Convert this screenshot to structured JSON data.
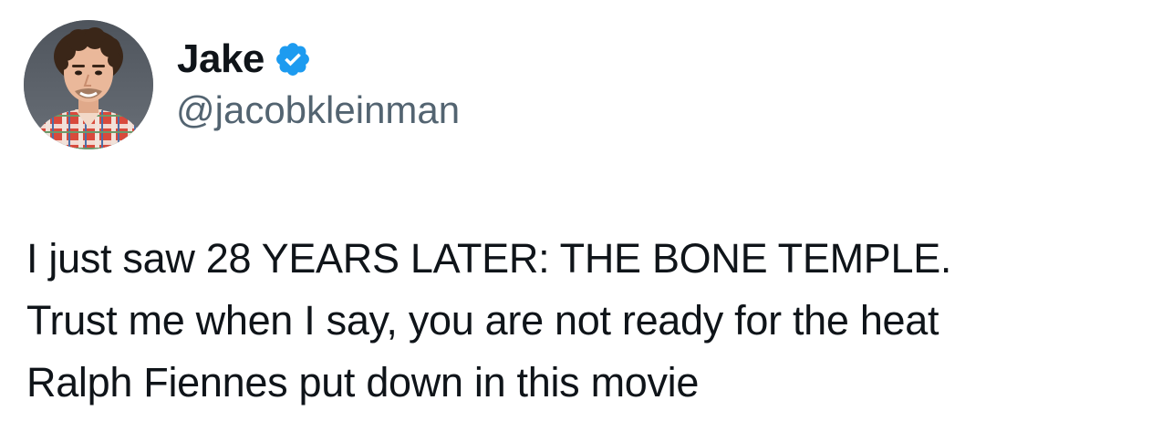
{
  "tweet": {
    "author": {
      "display_name": "Jake",
      "handle": "@jacobkleinman",
      "verified": true,
      "avatar_icon": "profile-photo"
    },
    "text_lines": [
      "I just saw 28 YEARS LATER: THE BONE TEMPLE.",
      "Trust me when I say, you are not ready for the heat",
      "Ralph Fiennes put down in this movie"
    ]
  },
  "colors": {
    "text_primary": "#0f1419",
    "text_secondary": "#536471",
    "verified_badge": "#1d9bf0",
    "background": "#ffffff"
  }
}
